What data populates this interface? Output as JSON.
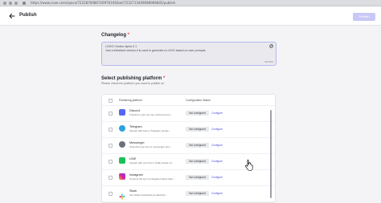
{
  "browser": {
    "url": "https://www.coze.com/space/7222870086726976106/bot/7232713409688968845/publish"
  },
  "header": {
    "title": "Publish",
    "publish_label": "Publish"
  },
  "changelog": {
    "title": "Changelog",
    "required_mark": "*",
    "text": "LOGO Creator alpha 0.1\nJust a initialized version,it is used to generate a LOGO based on user prompts.",
    "char_count": "96/2000"
  },
  "platforms": {
    "title": "Select publishing platform",
    "required_mark": "*",
    "description": "Please check the platform you want to publish on",
    "columns": [
      "Publishing platform",
      "Configuration Status"
    ],
    "rows": [
      {
        "name": "Discord",
        "desc": "Transform your bot into a Discord bot t...",
        "status": "Not configured",
        "action": "Configure",
        "icon": "discord-icon",
        "color": "#5865f2"
      },
      {
        "name": "Telegram",
        "desc": "Interact with bots in Telegram private...",
        "status": "Not configured",
        "action": "Configure",
        "icon": "telegram-icon",
        "color": "#2aa3de"
      },
      {
        "name": "Messenger",
        "desc": "Chat with your bot on messenger and ...",
        "status": "Not configured",
        "action": "Configure",
        "icon": "messenger-icon",
        "color": "#6b7080"
      },
      {
        "name": "LINE",
        "desc": "Interact with your bot in LINE private ch...",
        "status": "Not configured",
        "action": "Configure",
        "icon": "line-icon",
        "color": "#19c058"
      },
      {
        "name": "Instagram",
        "desc": "Connect the bot to Instagram Direct Mes...",
        "status": "Not configured",
        "action": "Configure",
        "icon": "instagram-icon",
        "color": "#d6249f"
      },
      {
        "name": "Slack",
        "desc": "Use Slack workspace productivity ...",
        "status": "Not configured",
        "action": "Configure",
        "icon": "slack-icon",
        "color": "#e01e5a"
      }
    ]
  }
}
